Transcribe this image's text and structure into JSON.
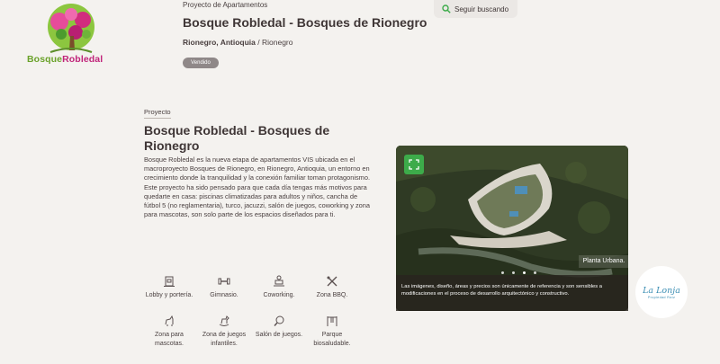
{
  "brand": {
    "logo_word1": "Bosque",
    "logo_word2": "Robledal"
  },
  "header": {
    "kicker": "Proyecto de Apartamentos",
    "title": "Bosque Robledal - Bosques de Rionegro",
    "location_bold": "Rionegro, Antioquia",
    "location_sep": " / ",
    "location_rest": "Rionegro",
    "status": "Vendido",
    "follow_label": "Seguir buscando",
    "follow_icon": "search-icon"
  },
  "project": {
    "section_label": "Proyecto",
    "title": "Bosque Robledal - Bosques de Rionegro",
    "paragraph1": "Bosque Robledal es la nueva etapa de apartamentos VIS ubicada en el macroproyecto Bosques de Rionegro, en Rionegro, Antioquia, un entorno en crecimiento donde la tranquilidad y la conexión familiar toman protagonismo.",
    "paragraph2": "Este proyecto ha sido pensado para que cada día tengas más motivos para quedarte en casa: piscinas climatizadas para adultos y niños, cancha de fútbol 5 (no reglamentaria), turco, jacuzzi, salón de juegos, coworking y zona para mascotas, son solo parte de los espacios diseñados para ti."
  },
  "amenities": [
    {
      "label": "Lobby y portería.",
      "icon": "lobby-icon"
    },
    {
      "label": "Gimnasio.",
      "icon": "dumbbell-icon"
    },
    {
      "label": "Coworking.",
      "icon": "coworking-icon"
    },
    {
      "label": "Zona BBQ.",
      "icon": "bbq-icon"
    },
    {
      "label": "Zona para mascotas.",
      "icon": "pet-icon"
    },
    {
      "label": "Zona de juegos infantiles.",
      "icon": "rocking-horse-icon"
    },
    {
      "label": "Salón de juegos.",
      "icon": "ping-pong-icon"
    },
    {
      "label": "Parque biosaludable.",
      "icon": "fitness-park-icon"
    }
  ],
  "media": {
    "caption": "Planta Urbana.",
    "disclaimer": "Las imágenes, diseño, áreas y precios son únicamente de referencia y son sensibles a modificaciones en el proceso de desarrollo arquitectónico y constructivo.",
    "expand_icon": "expand-icon",
    "slide_count": 4,
    "active_slide": 3
  },
  "partner": {
    "name": "La Lonja",
    "tagline": "Propiedad Raíz"
  },
  "colors": {
    "background": "#f4f2ef",
    "accent_green": "#3dab4a",
    "brand_magenta": "#c0247a",
    "brand_green": "#6aa22a"
  }
}
